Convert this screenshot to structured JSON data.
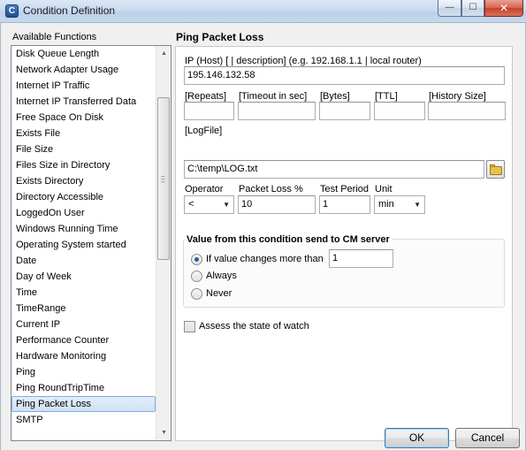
{
  "window": {
    "title": "Condition Definition",
    "app_icon": "C",
    "minimize_icon": "—",
    "maximize_icon": "☐",
    "close_icon": "✕"
  },
  "functions": {
    "label": "Available Functions",
    "items": [
      "Disk Queue Length",
      "Network Adapter Usage",
      "Internet IP Traffic",
      "Internet IP Transferred Data",
      "Free Space On Disk",
      "Exists File",
      "File Size",
      "Files Size in Directory",
      "Exists Directory",
      "Directory Accessible",
      "LoggedOn User",
      "Windows Running Time",
      "Operating System started",
      "Date",
      "Day of Week",
      "Time",
      "TimeRange",
      "Current IP",
      "Performance Counter",
      "Hardware Monitoring",
      "Ping",
      "Ping RoundTripTime",
      "Ping Packet Loss",
      "SMTP"
    ],
    "selected": "Ping Packet Loss",
    "scroll_up": "▲",
    "scroll_down": "▼"
  },
  "form": {
    "title": "Ping Packet Loss",
    "host_label": "IP (Host) [ | description]   (e.g. 192.168.1.1 | local router)",
    "host_value": "195.146.132.58",
    "repeats_label": "[Repeats]",
    "repeats_value": "",
    "timeout_label": "[Timeout in sec]",
    "timeout_value": "",
    "bytes_label": "[Bytes]",
    "bytes_value": "",
    "ttl_label": "[TTL]",
    "ttl_value": "",
    "history_label": "[History Size]",
    "history_value": "",
    "logfile_label": "[LogFile]",
    "logfile_value": "C:\\temp\\LOG.txt",
    "operator_label": "Operator",
    "operator_value": "<",
    "packetloss_label": "Packet Loss %",
    "packetloss_value": "10",
    "testperiod_label": "Test Period",
    "testperiod_value": "1",
    "unit_label": "Unit",
    "unit_value": "min",
    "group_title": "Value from this condition send to CM server",
    "radio_change_label": "If value changes more than",
    "radio_change_value": "1",
    "radio_always_label": "Always",
    "radio_never_label": "Never",
    "selected_radio": "If value changes more than",
    "assess_label": "Assess the state of watch",
    "assess_checked": false
  },
  "buttons": {
    "ok": "OK",
    "cancel": "Cancel"
  }
}
